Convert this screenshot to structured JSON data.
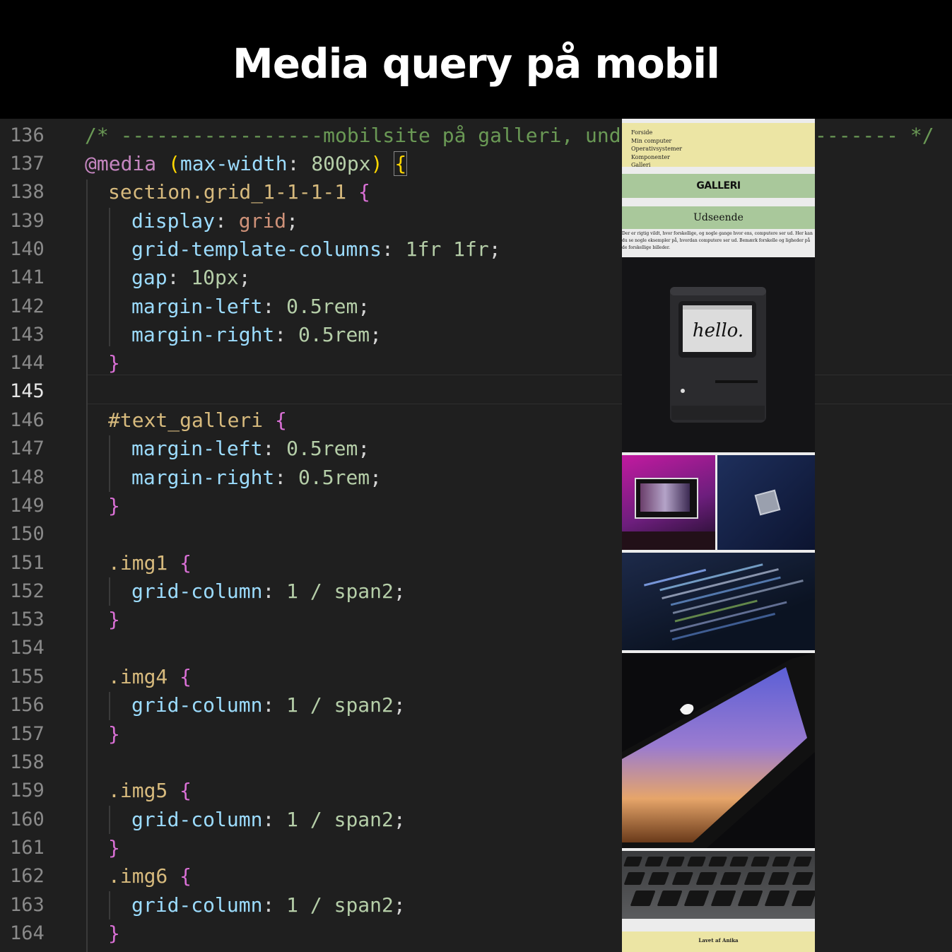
{
  "banner": {
    "title": "Media query på mobil"
  },
  "editor": {
    "current_line": "145",
    "lines": [
      {
        "n": "136"
      },
      {
        "n": "137"
      },
      {
        "n": "138"
      },
      {
        "n": "139"
      },
      {
        "n": "140"
      },
      {
        "n": "141"
      },
      {
        "n": "142"
      },
      {
        "n": "143"
      },
      {
        "n": "144"
      },
      {
        "n": "145"
      },
      {
        "n": "146"
      },
      {
        "n": "147"
      },
      {
        "n": "148"
      },
      {
        "n": "149"
      },
      {
        "n": "150"
      },
      {
        "n": "151"
      },
      {
        "n": "152"
      },
      {
        "n": "153"
      },
      {
        "n": "154"
      },
      {
        "n": "155"
      },
      {
        "n": "156"
      },
      {
        "n": "157"
      },
      {
        "n": "158"
      },
      {
        "n": "159"
      },
      {
        "n": "160"
      },
      {
        "n": "161"
      },
      {
        "n": "162"
      },
      {
        "n": "163"
      },
      {
        "n": "164"
      }
    ],
    "code": {
      "l136_comment": "/* -----------------mobilsite på galleri, under",
      "l136_comment_end": "------- */",
      "l137_at": "@media",
      "l137_open": "(",
      "l137_prop": "max-width",
      "l137_colon": ":",
      "l137_val": "800px",
      "l137_close": ")",
      "l137_brace": "{",
      "l138_sel": "section.grid_1-1-1-1",
      "l138_brace": "{",
      "l139_prop": "display",
      "l139_val": "grid",
      "l140_prop": "grid-template-columns",
      "l140_val": "1fr 1fr",
      "l141_prop": "gap",
      "l141_val": "10px",
      "l142_prop": "margin-left",
      "l142_val": "0.5rem",
      "l143_prop": "margin-right",
      "l143_val": "0.5rem",
      "l144_brace": "}",
      "l146_sel": "#text_galleri",
      "l146_brace": "{",
      "l147_prop": "margin-left",
      "l147_val": "0.5rem",
      "l148_prop": "margin-right",
      "l148_val": "0.5rem",
      "l149_brace": "}",
      "l151_sel": ".img1",
      "l151_brace": "{",
      "l152_prop": "grid-column",
      "l152_val": "1 / span2",
      "l153_brace": "}",
      "l155_sel": ".img4",
      "l155_brace": "{",
      "l156_prop": "grid-column",
      "l156_val": "1 / span2",
      "l157_brace": "}",
      "l159_sel": ".img5",
      "l159_brace": "{",
      "l160_prop": "grid-column",
      "l160_val": "1 / span2",
      "l161_brace": "}",
      "l162_sel": ".img6",
      "l162_brace": "{",
      "l163_prop": "grid-column",
      "l163_val": "1 / span2",
      "l164_brace": "}"
    },
    "colors": {
      "background": "#1f1f1f",
      "comment": "#6a9955",
      "keyword": "#c586c0",
      "property": "#9cdcfe",
      "selector": "#d7ba7d",
      "number": "#b5cea8",
      "string": "#ce9178"
    }
  },
  "preview": {
    "nav_items": [
      "Forside",
      "Min computer",
      "Operativsystemer",
      "Komponenter",
      "Galleri"
    ],
    "section_title": "GALLERI",
    "subheading": "Udseende",
    "description": "Der er rigtig vildt, hvor forskellige, og nogle gange hvor ens, computere ser ud. Her kan du se nogle eksempler på, hvordan computere ser ud. Bemærk forskelle og ligheder på de forskellige billeder.",
    "hello_text": "hello.",
    "footer": "Lavet af Anika",
    "colors": {
      "nav_bg": "#ece5a4",
      "bar_bg": "#a9c89b",
      "page_bg": "#ececec"
    }
  }
}
